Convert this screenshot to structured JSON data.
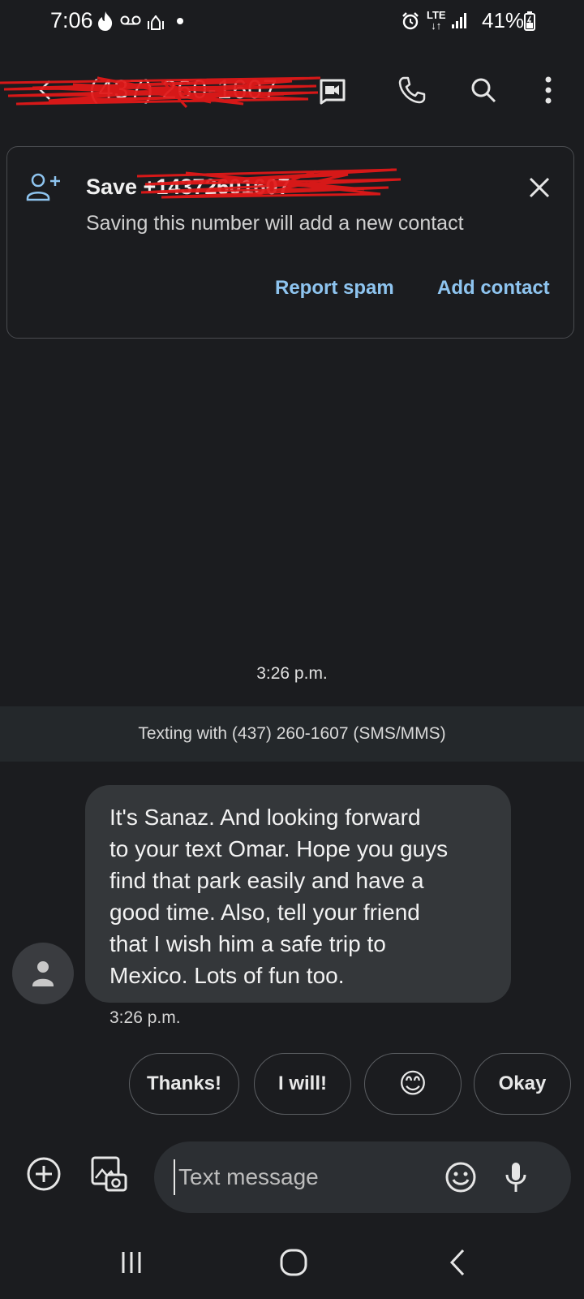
{
  "status_bar": {
    "time": "7:06",
    "battery": "41%",
    "icons": [
      "tinder-flame-icon",
      "voicemail-icon",
      "mosque-icon",
      "dot-icon",
      "alarm-icon",
      "lte-icon",
      "signal-icon",
      "battery-icon"
    ]
  },
  "app_bar": {
    "title": "(437) 260-1607",
    "icons": [
      "back-arrow-icon",
      "video-call-icon",
      "phone-icon",
      "search-icon",
      "more-vert-icon"
    ]
  },
  "save_card": {
    "title": "Save +14372601607",
    "subtitle": "Saving this number will add a new contact",
    "report_spam": "Report spam",
    "add_contact": "Add contact",
    "icons": [
      "add-person-icon",
      "close-icon"
    ]
  },
  "conversation": {
    "time_divider": "3:26 p.m.",
    "texting_banner": "Texting with (437) 260-1607 (SMS/MMS)",
    "messages": [
      {
        "lines": [
          "It's Sanaz. And looking forward",
          "to your text Omar. Hope you guys",
          "find that park easily and have a",
          "good time. Also, tell your friend",
          "that I wish him a safe trip to",
          "Mexico. Lots of fun too."
        ],
        "time": "3:26 p.m."
      }
    ]
  },
  "smart_replies": [
    "Thanks!",
    "I will!",
    "😊",
    "Okay"
  ],
  "composer": {
    "placeholder": "Text message",
    "icons": [
      "add-circle-icon",
      "gallery-camera-icon",
      "emoji-icon",
      "mic-icon"
    ]
  },
  "nav_bar": {
    "icons": [
      "recent-apps-icon",
      "home-icon",
      "back-nav-icon"
    ]
  },
  "colors": {
    "background": "#1b1c1f",
    "accent_link": "#8ec4ef",
    "bubble": "#34373a",
    "banner": "#24282b",
    "redaction": "#e01818"
  }
}
